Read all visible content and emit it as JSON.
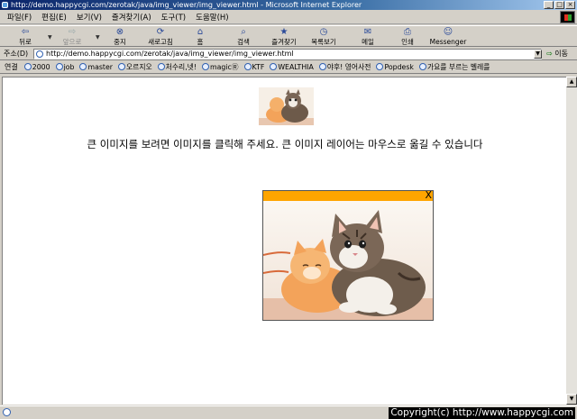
{
  "window": {
    "title": "http://demo.happycgi.com/zerotak/java/img_viewer/img_viewer.html - Microsoft Internet Explorer",
    "minimize": "_",
    "maximize": "□",
    "close": "×"
  },
  "menu": [
    "파일(F)",
    "편집(E)",
    "보기(V)",
    "즐겨찾기(A)",
    "도구(T)",
    "도움말(H)"
  ],
  "toolbar": {
    "back": "뒤로",
    "forward": "앞으로",
    "stop": "중지",
    "refresh": "새로고침",
    "home": "홈",
    "search": "검색",
    "favorites": "즐겨찾기",
    "history": "목록보기",
    "mail": "메일",
    "print": "인쇄",
    "messenger": "Messenger"
  },
  "address": {
    "label": "주소(D)",
    "url": "http://demo.happycgi.com/zerotak/java/img_viewer/img_viewer.html",
    "go": "이동"
  },
  "links": {
    "label": "연결",
    "items": [
      "2000",
      "job",
      "master",
      "오르지오",
      "처수리,넷!",
      "magicⓇ",
      "KTF",
      "WEALTHIA",
      "야후! 영어사전",
      "Popdesk",
      "가요를 부르는 벨레를"
    ]
  },
  "page": {
    "instructions": "큰 이미지를 보려면 이미지를 클릭해 주세요. 큰 이미지 레이어는 마우스로 옮길 수 있습니다",
    "layer_close": "X"
  },
  "status": {
    "copyright": "Copyright(c) http://www.happycgi.com"
  }
}
